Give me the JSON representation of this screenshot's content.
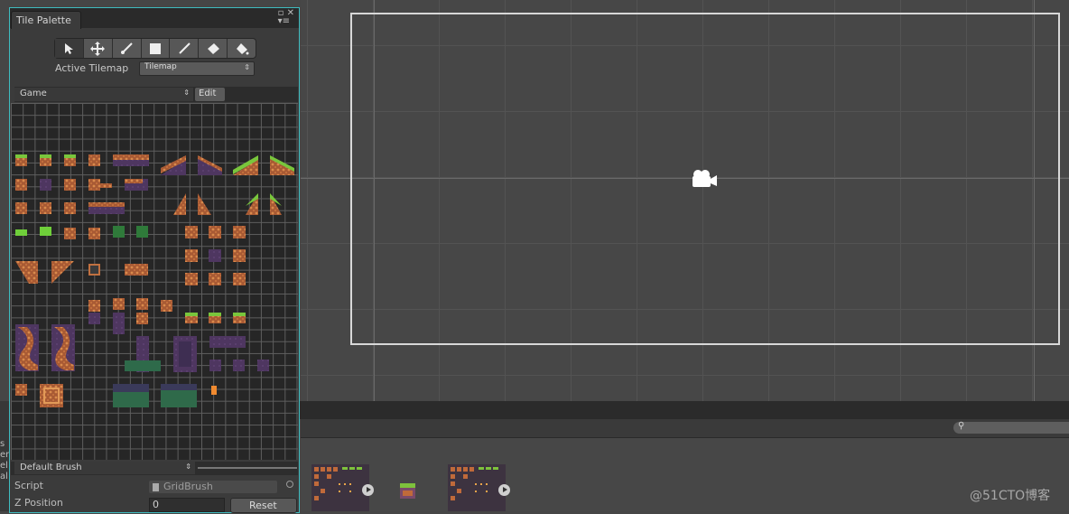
{
  "palette_window": {
    "tab_label": "Tile Palette",
    "active_tilemap_label": "Active Tilemap",
    "active_tilemap_value": "Tilemap",
    "palette_name": "Game",
    "edit_label": "Edit",
    "tools": [
      "select-icon",
      "move-icon",
      "paint-brush-icon",
      "box-fill-icon",
      "picker-icon",
      "eraser-icon",
      "fill-icon"
    ],
    "brush_name": "Default Brush",
    "script_label": "Script",
    "script_value": "GridBrush",
    "z_label": "Z Position",
    "z_value": "0",
    "reset_label": "Reset"
  },
  "left_edge_text": [
    "s",
    "er",
    "el",
    "al"
  ],
  "watermark": "@51CTO博客",
  "colors": {
    "accent": "#3fbcc0",
    "tile_dirt": "#b96a3a",
    "tile_purple": "#5a3a6a",
    "tile_grass": "#6fcf3a"
  }
}
